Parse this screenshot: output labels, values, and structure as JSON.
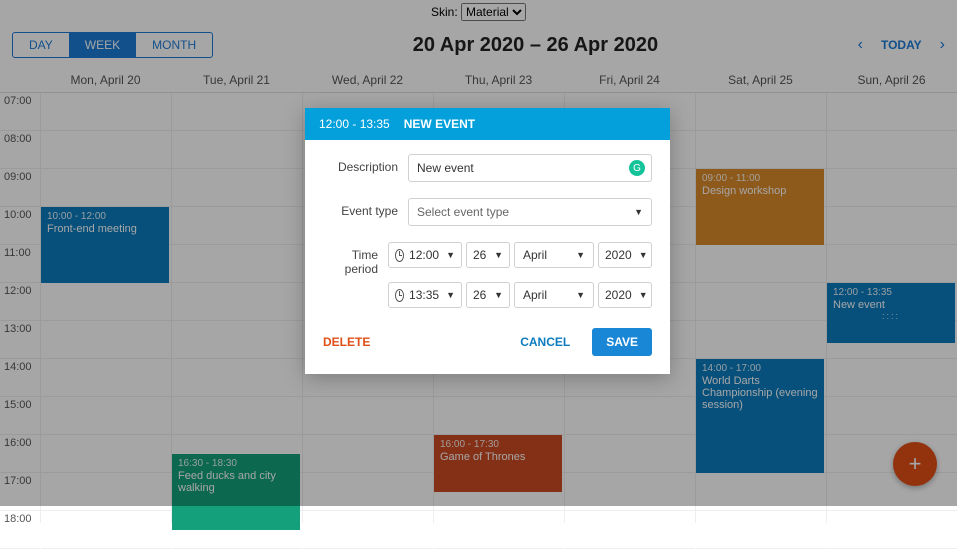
{
  "skin": {
    "label": "Skin:",
    "value": "Material"
  },
  "views": {
    "day": "DAY",
    "week": "WEEK",
    "month": "MONTH",
    "active": "WEEK"
  },
  "range_title": "20 Apr 2020 – 26 Apr 2020",
  "today_label": "TODAY",
  "day_headers": [
    "Mon, April 20",
    "Tue, April 21",
    "Wed, April 22",
    "Thu, April 23",
    "Fri, April 24",
    "Sat, April 25",
    "Sun, April 26"
  ],
  "hours": [
    "07:00",
    "08:00",
    "09:00",
    "10:00",
    "11:00",
    "12:00",
    "13:00",
    "14:00",
    "15:00",
    "16:00",
    "17:00",
    "18:00"
  ],
  "events": {
    "frontend": {
      "time": "10:00 - 12:00",
      "title": "Front-end meeting"
    },
    "ducks": {
      "time": "16:30 - 18:30",
      "title": "Feed ducks and city walking"
    },
    "got": {
      "time": "16:00 - 17:30",
      "title": "Game of Thrones"
    },
    "design": {
      "time": "09:00 - 11:00",
      "title": "Design workshop"
    },
    "darts": {
      "time": "14:00 - 17:00",
      "title": "World Darts Championship (evening session)"
    },
    "newevent": {
      "time": "12:00 - 13:35",
      "title": "New event"
    }
  },
  "modal": {
    "head_time": "12:00 - 13:35",
    "head_title": "NEW EVENT",
    "labels": {
      "description": "Description",
      "event_type": "Event type",
      "time_period": "Time period"
    },
    "description_value": "New event",
    "event_type_placeholder": "Select event type",
    "start": {
      "time": "12:00",
      "day": "26",
      "month": "April",
      "year": "2020"
    },
    "end": {
      "time": "13:35",
      "day": "26",
      "month": "April",
      "year": "2020"
    },
    "buttons": {
      "delete": "DELETE",
      "cancel": "CANCEL",
      "save": "SAVE"
    }
  },
  "fab_icon": "+"
}
